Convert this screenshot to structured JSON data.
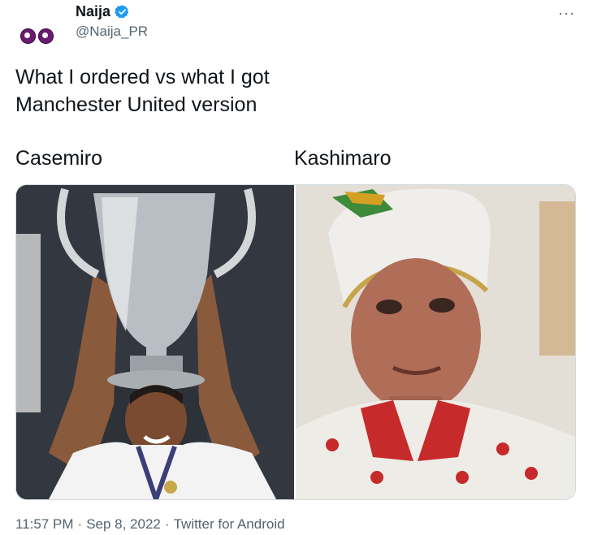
{
  "author": {
    "display_name": "Naija",
    "handle": "@Naija_PR",
    "verified_icon": "verified-badge-icon",
    "avatar_icon": "eyes-emoji-icon"
  },
  "tweet": {
    "text_line1": "What I ordered vs what I got",
    "text_line2": "Manchester United version",
    "more_label": "···"
  },
  "captions": {
    "left": "Casemiro",
    "right": "Kashimaro"
  },
  "meta": {
    "time": "11:57 PM",
    "date": "Sep 8, 2022",
    "source": "Twitter for Android",
    "separator": "·"
  },
  "colors": {
    "text_primary": "#0f1419",
    "text_secondary": "#536471",
    "verified_blue": "#1d9bf0",
    "border": "#cfd9de"
  }
}
